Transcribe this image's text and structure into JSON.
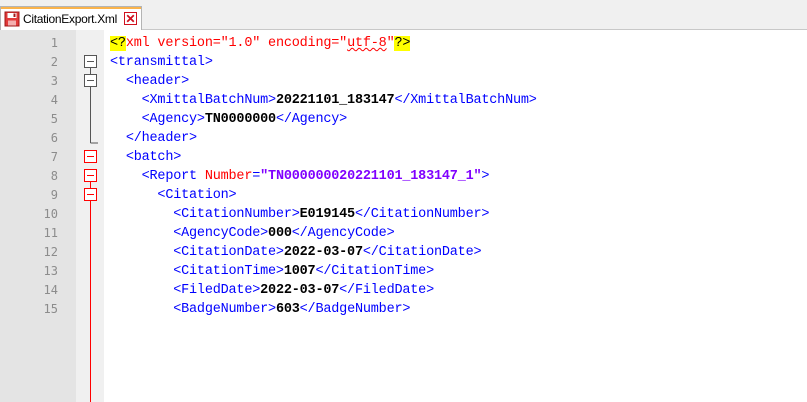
{
  "tab": {
    "title": "CitationExport.Xml",
    "file_icon": "save-disk-icon",
    "close_icon": "close-icon"
  },
  "colors": {
    "tag": "#0000ff",
    "text": "#000000",
    "attr": "#ff0000",
    "value": "#8000ff",
    "fold_active": "#ff0000",
    "highlight": "#ffff00"
  },
  "lines": [
    {
      "num": "1",
      "pi_open": "<?",
      "pi_body": "xml version=\"1.0\" encoding=\"",
      "pi_enc": "utf-8",
      "pi_quote": "\"",
      "pi_close": "?>"
    },
    {
      "num": "2",
      "indent": "",
      "open": "<transmittal>"
    },
    {
      "num": "3",
      "indent": "  ",
      "open": "<header>"
    },
    {
      "num": "4",
      "indent": "    ",
      "open": "<XmittalBatchNum>",
      "text": "20221101_183147",
      "close": "</XmittalBatchNum>"
    },
    {
      "num": "5",
      "indent": "    ",
      "open": "<Agency>",
      "text": "TN0000000",
      "close": "</Agency>"
    },
    {
      "num": "6",
      "indent": "  ",
      "open": "</header>"
    },
    {
      "num": "7",
      "indent": "  ",
      "open": "<batch>"
    },
    {
      "num": "8",
      "indent": "    ",
      "tag_start": "<Report ",
      "attr": "Number",
      "eq": "=",
      "val": "\"TN000000020221101_183147_1\"",
      "tag_end": ">"
    },
    {
      "num": "9",
      "indent": "      ",
      "open": "<Citation>"
    },
    {
      "num": "10",
      "indent": "        ",
      "open": "<CitationNumber>",
      "text": "E019145",
      "close": "</CitationNumber>"
    },
    {
      "num": "11",
      "indent": "        ",
      "open": "<AgencyCode>",
      "text": "000",
      "close": "</AgencyCode>"
    },
    {
      "num": "12",
      "indent": "        ",
      "open": "<CitationDate>",
      "text": "2022-03-07",
      "close": "</CitationDate>"
    },
    {
      "num": "13",
      "indent": "        ",
      "open": "<CitationTime>",
      "text": "1007",
      "close": "</CitationTime>"
    },
    {
      "num": "14",
      "indent": "        ",
      "open": "<FiledDate>",
      "text": "2022-03-07",
      "close": "</FiledDate>"
    },
    {
      "num": "15",
      "indent": "        ",
      "open": "<BadgeNumber>",
      "text": "603",
      "close": "</BadgeNumber>"
    }
  ]
}
